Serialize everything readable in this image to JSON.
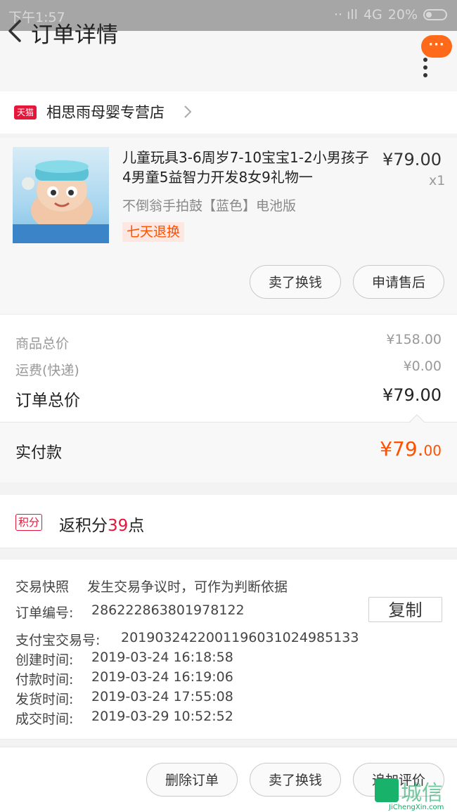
{
  "status_bar": {
    "time": "下午1:57",
    "network": "4G",
    "battery": "20%"
  },
  "header": {
    "title": "订单详情",
    "more_label": "···"
  },
  "store": {
    "badge": "天猫",
    "name": "相思雨母婴专营店"
  },
  "product": {
    "title": "儿童玩具3-6周岁7-10宝宝1-2小男孩子4男童5益智力开发8女9礼物一",
    "sku": "不倒翁手拍鼓【蓝色】电池版",
    "price": "¥79.00",
    "quantity": "x1",
    "tag": "七天退换",
    "buttons": {
      "sell": "卖了换钱",
      "after_sale": "申请售后"
    }
  },
  "summary": {
    "goods_label": "商品总价",
    "goods_value": "¥158.00",
    "shipping_label": "运费(快递)",
    "shipping_value": "¥0.00",
    "total_label": "订单总价",
    "total_value": "¥79.00",
    "paid_label": "实付款",
    "paid_int": "¥79.",
    "paid_dec": "00"
  },
  "points": {
    "badge": "积分",
    "prefix": "返积分",
    "value": "39",
    "suffix": "点"
  },
  "info": {
    "snapshot_label": "交易快照",
    "snapshot_desc": "发生交易争议时，可作为判断依据",
    "order_no_label": "订单编号:",
    "order_no": "286222863801978122",
    "copy_label": "复制",
    "alipay_label": "支付宝交易号:",
    "alipay_no": "2019032422001196031024985133",
    "created_label": "创建时间:",
    "created": "2019-03-24 16:18:58",
    "paid_label": "付款时间:",
    "paid": "2019-03-24 16:19:06",
    "shipped_label": "发货时间:",
    "shipped": "2019-03-24 17:55:08",
    "done_label": "成交时间:",
    "done": "2019-03-29 10:52:52"
  },
  "bottom": {
    "delete": "删除订单",
    "sell": "卖了换钱",
    "review": "追加评价"
  },
  "watermark": {
    "text": "城信",
    "url": "JiChengXin.com"
  },
  "colors": {
    "accent": "#ff5000",
    "tmall": "#e4163a",
    "status_bar": "#a6a6a6"
  }
}
